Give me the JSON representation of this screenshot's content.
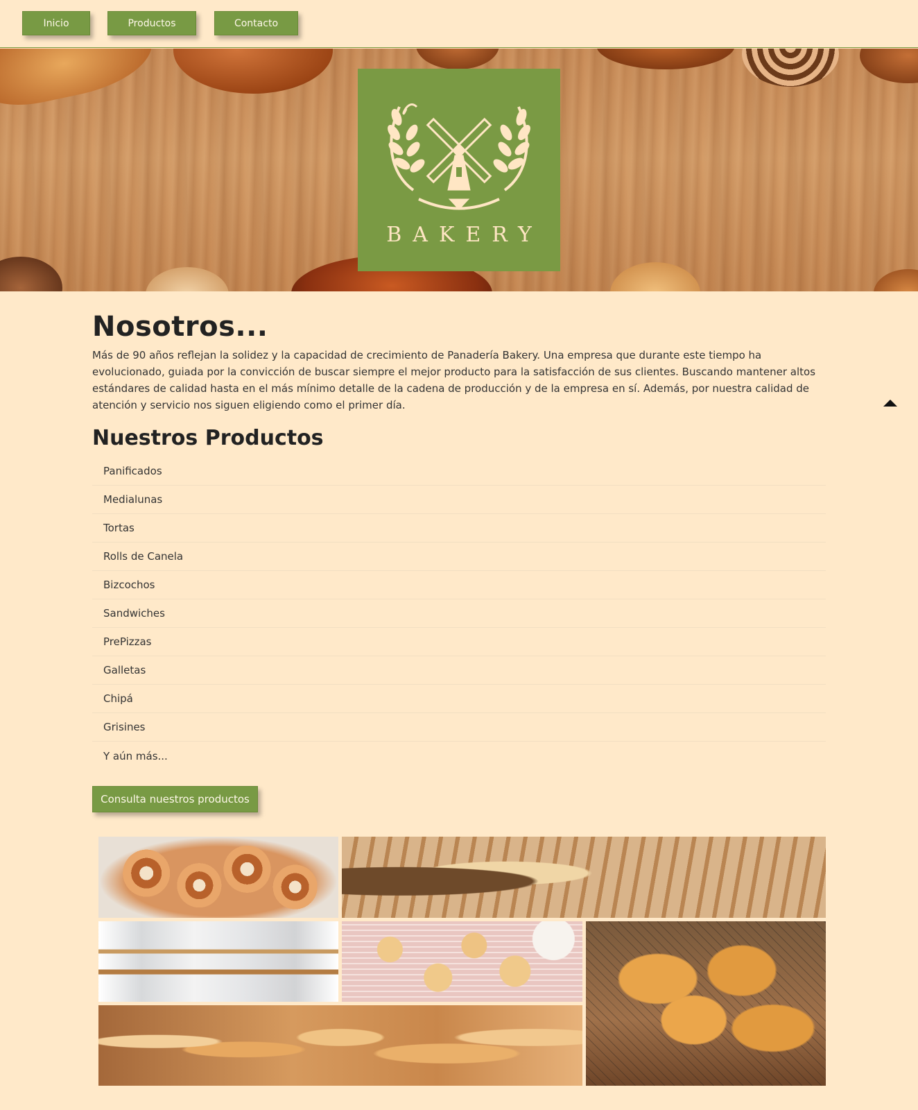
{
  "nav": {
    "items": [
      {
        "label": "Inicio"
      },
      {
        "label": "Productos"
      },
      {
        "label": "Contacto"
      }
    ]
  },
  "hero": {
    "logo_text": "BAKERY"
  },
  "about": {
    "title": "Nosotros...",
    "text": "Más de 90 años reflejan la solidez y la capacidad de crecimiento de Panadería Bakery. Una empresa que durante este tiempo ha evolucionado, guiada por la convicción de buscar siempre el mejor producto para la satisfacción de sus clientes. Buscando mantener altos estándares de calidad hasta en el más mínimo detalle de la cadena de producción y de la empresa en sí. Además, por nuestra calidad de atención y servicio nos siguen eligiendo como el primer día."
  },
  "products": {
    "title": "Nuestros Productos",
    "items": [
      "Panificados",
      "Medialunas",
      "Tortas",
      "Rolls de Canela",
      "Bizcochos",
      "Sandwiches",
      "PrePizzas",
      "Galletas",
      "Chipá",
      "Grisines",
      "Y aún más..."
    ],
    "cta_label": "Consulta nuestros productos"
  },
  "gallery": {
    "images": [
      "cinnamon-rolls-photo",
      "bread-loaves-wheat-photo",
      "bakery-shop-interior-photo",
      "cookies-bizcochos-photo",
      "croissants-rack-photo",
      "assorted-breads-photo"
    ]
  },
  "colors": {
    "background": "#ffe9c9",
    "accent": "#789a44",
    "logo_bg": "#7a9a44",
    "logo_fg": "#ffe6c4"
  }
}
